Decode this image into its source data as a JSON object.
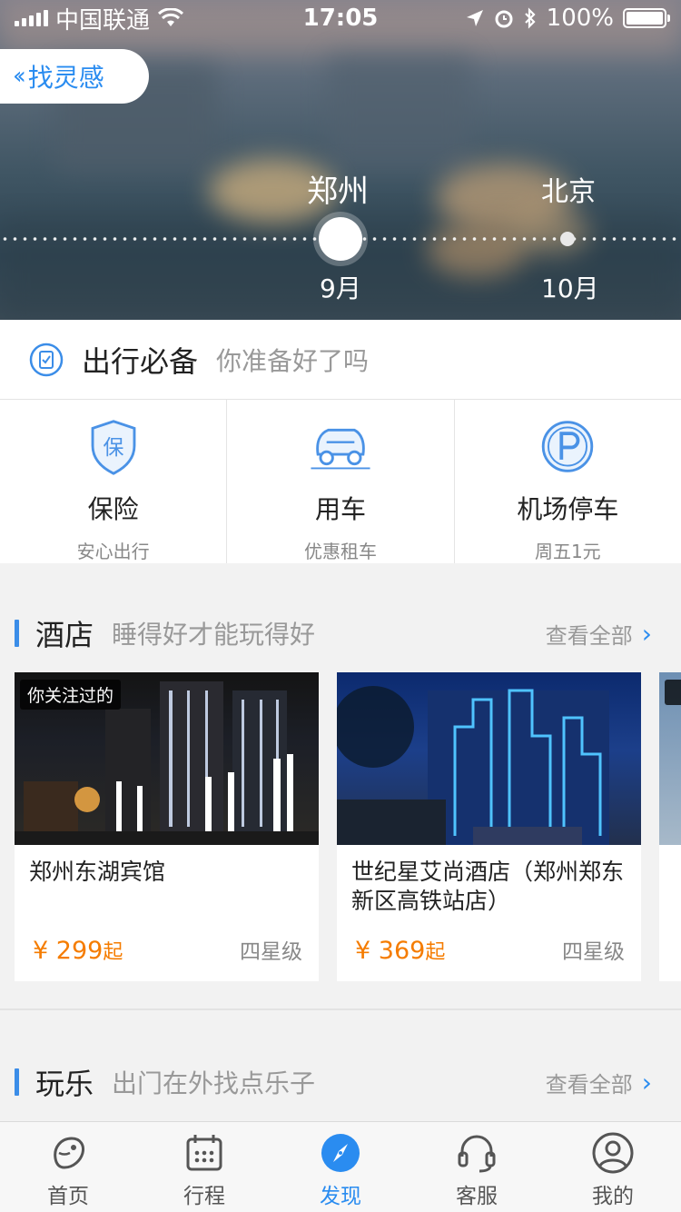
{
  "status_bar": {
    "carrier": "中国联通",
    "time": "17:05",
    "battery": "100%"
  },
  "hero": {
    "back_label": "找灵感",
    "cities": [
      "郑州",
      "北京"
    ],
    "months": [
      "9月",
      "10月"
    ]
  },
  "essentials": {
    "title": "出行必备",
    "subtitle": "你准备好了吗",
    "items": [
      {
        "label": "保险",
        "sub": "安心出行",
        "icon": "insurance-shield-icon",
        "glyph": "保"
      },
      {
        "label": "用车",
        "sub": "优惠租车",
        "icon": "car-icon"
      },
      {
        "label": "机场停车",
        "sub": "周五1元",
        "icon": "parking-icon"
      }
    ]
  },
  "hotels": {
    "title": "酒店",
    "subtitle": "睡得好才能玩得好",
    "more": "查看全部",
    "cards": [
      {
        "tag": "你关注过的",
        "name": "郑州东湖宾馆",
        "price_symbol": "¥",
        "price": "299",
        "price_suffix": "起",
        "star": "四星级"
      },
      {
        "name": "世纪星艾尚酒店（郑州郑东新区高铁站店）",
        "price_symbol": "¥",
        "price": "369",
        "price_suffix": "起",
        "star": "四星级"
      }
    ]
  },
  "play": {
    "title": "玩乐",
    "subtitle": "出门在外找点乐子",
    "more": "查看全部"
  },
  "tabbar": {
    "items": [
      {
        "label": "首页",
        "icon": "home-dolphin-icon"
      },
      {
        "label": "行程",
        "icon": "calendar-icon"
      },
      {
        "label": "发现",
        "icon": "compass-icon",
        "active": true
      },
      {
        "label": "客服",
        "icon": "headset-icon"
      },
      {
        "label": "我的",
        "icon": "profile-icon"
      }
    ]
  },
  "colors": {
    "accent": "#2a8cf0",
    "price": "#f57c00"
  }
}
